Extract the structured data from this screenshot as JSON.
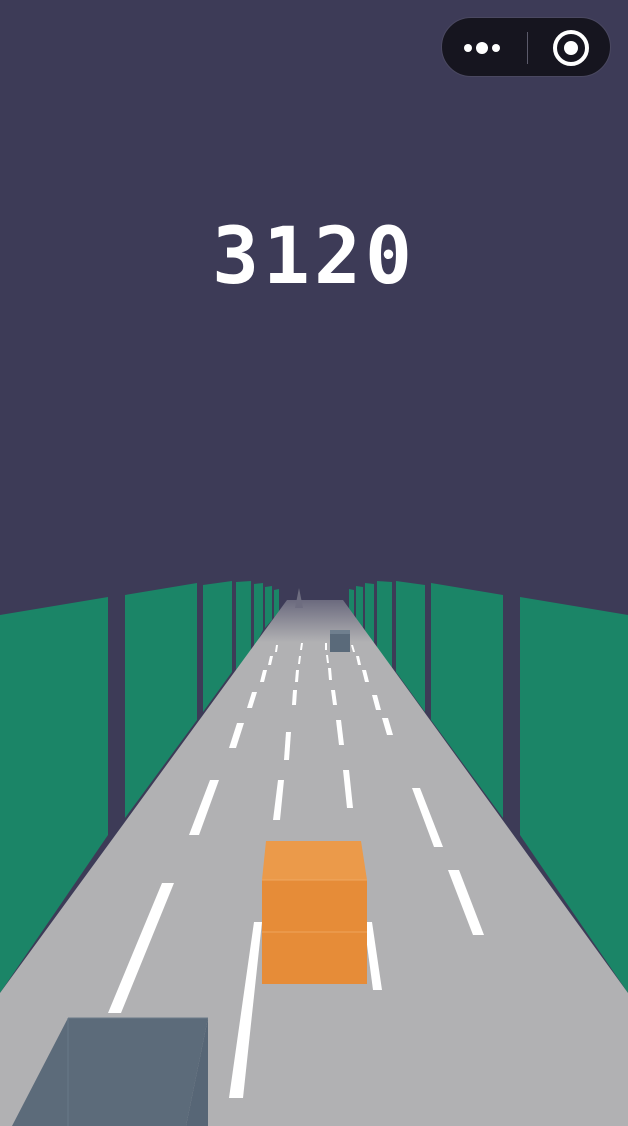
{
  "hud": {
    "score": "3120"
  },
  "capsule": {
    "icons": [
      "more-dots-icon",
      "target-icon"
    ]
  },
  "colors": {
    "sky": "#3d3b57",
    "road": "#b1b1b3",
    "wall": "#1b8567",
    "lane_marking": "#ffffff",
    "player_block": "#e68c38",
    "obstacle_block": "#5a6a7a"
  }
}
